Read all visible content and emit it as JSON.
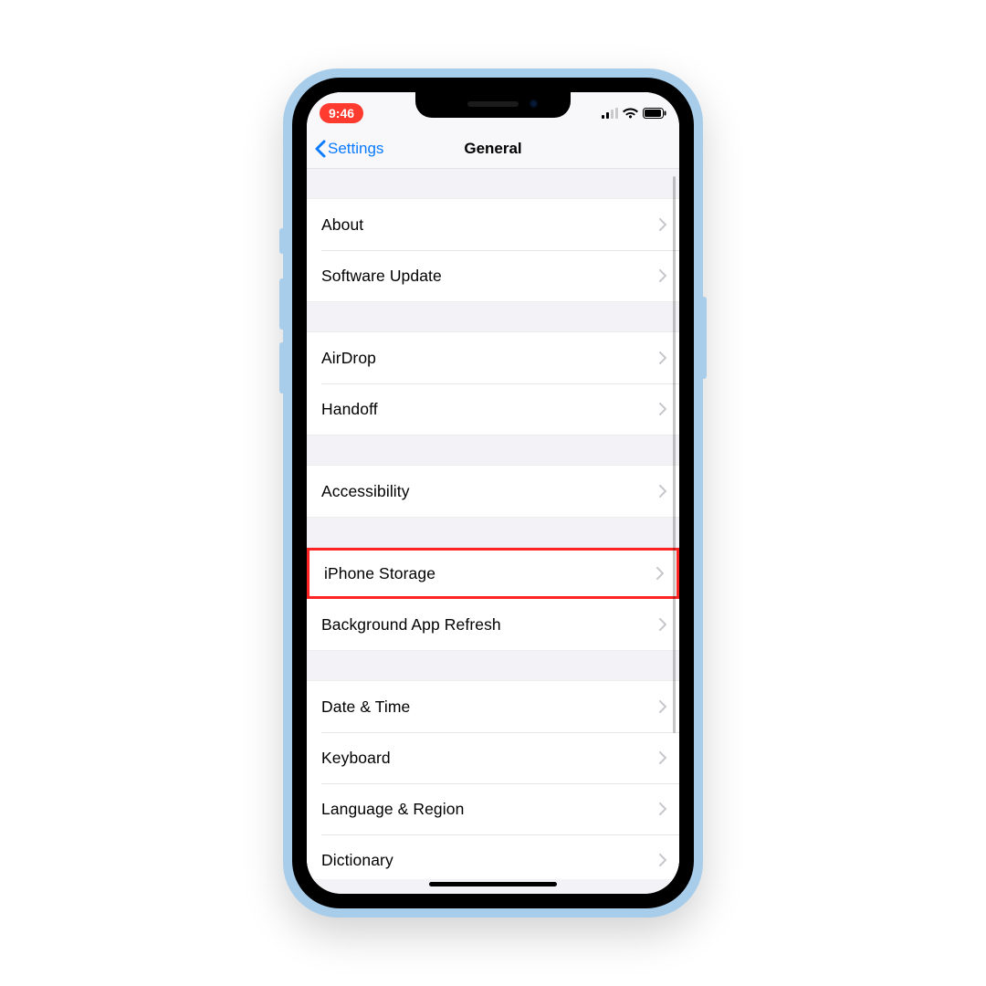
{
  "status": {
    "time": "9:46",
    "recording_color": "#ff3b30"
  },
  "nav": {
    "back_label": "Settings",
    "title": "General",
    "tint": "#0a7aff"
  },
  "groups": [
    {
      "rows": [
        {
          "label": "About",
          "highlight": false
        },
        {
          "label": "Software Update",
          "highlight": false
        }
      ]
    },
    {
      "rows": [
        {
          "label": "AirDrop",
          "highlight": false
        },
        {
          "label": "Handoff",
          "highlight": false
        }
      ]
    },
    {
      "rows": [
        {
          "label": "Accessibility",
          "highlight": false
        }
      ]
    },
    {
      "rows": [
        {
          "label": "iPhone Storage",
          "highlight": true
        },
        {
          "label": "Background App Refresh",
          "highlight": false
        }
      ]
    },
    {
      "rows": [
        {
          "label": "Date & Time",
          "highlight": false
        },
        {
          "label": "Keyboard",
          "highlight": false
        },
        {
          "label": "Language & Region",
          "highlight": false
        },
        {
          "label": "Dictionary",
          "highlight": false
        }
      ]
    }
  ],
  "highlight_color": "#ff2424"
}
